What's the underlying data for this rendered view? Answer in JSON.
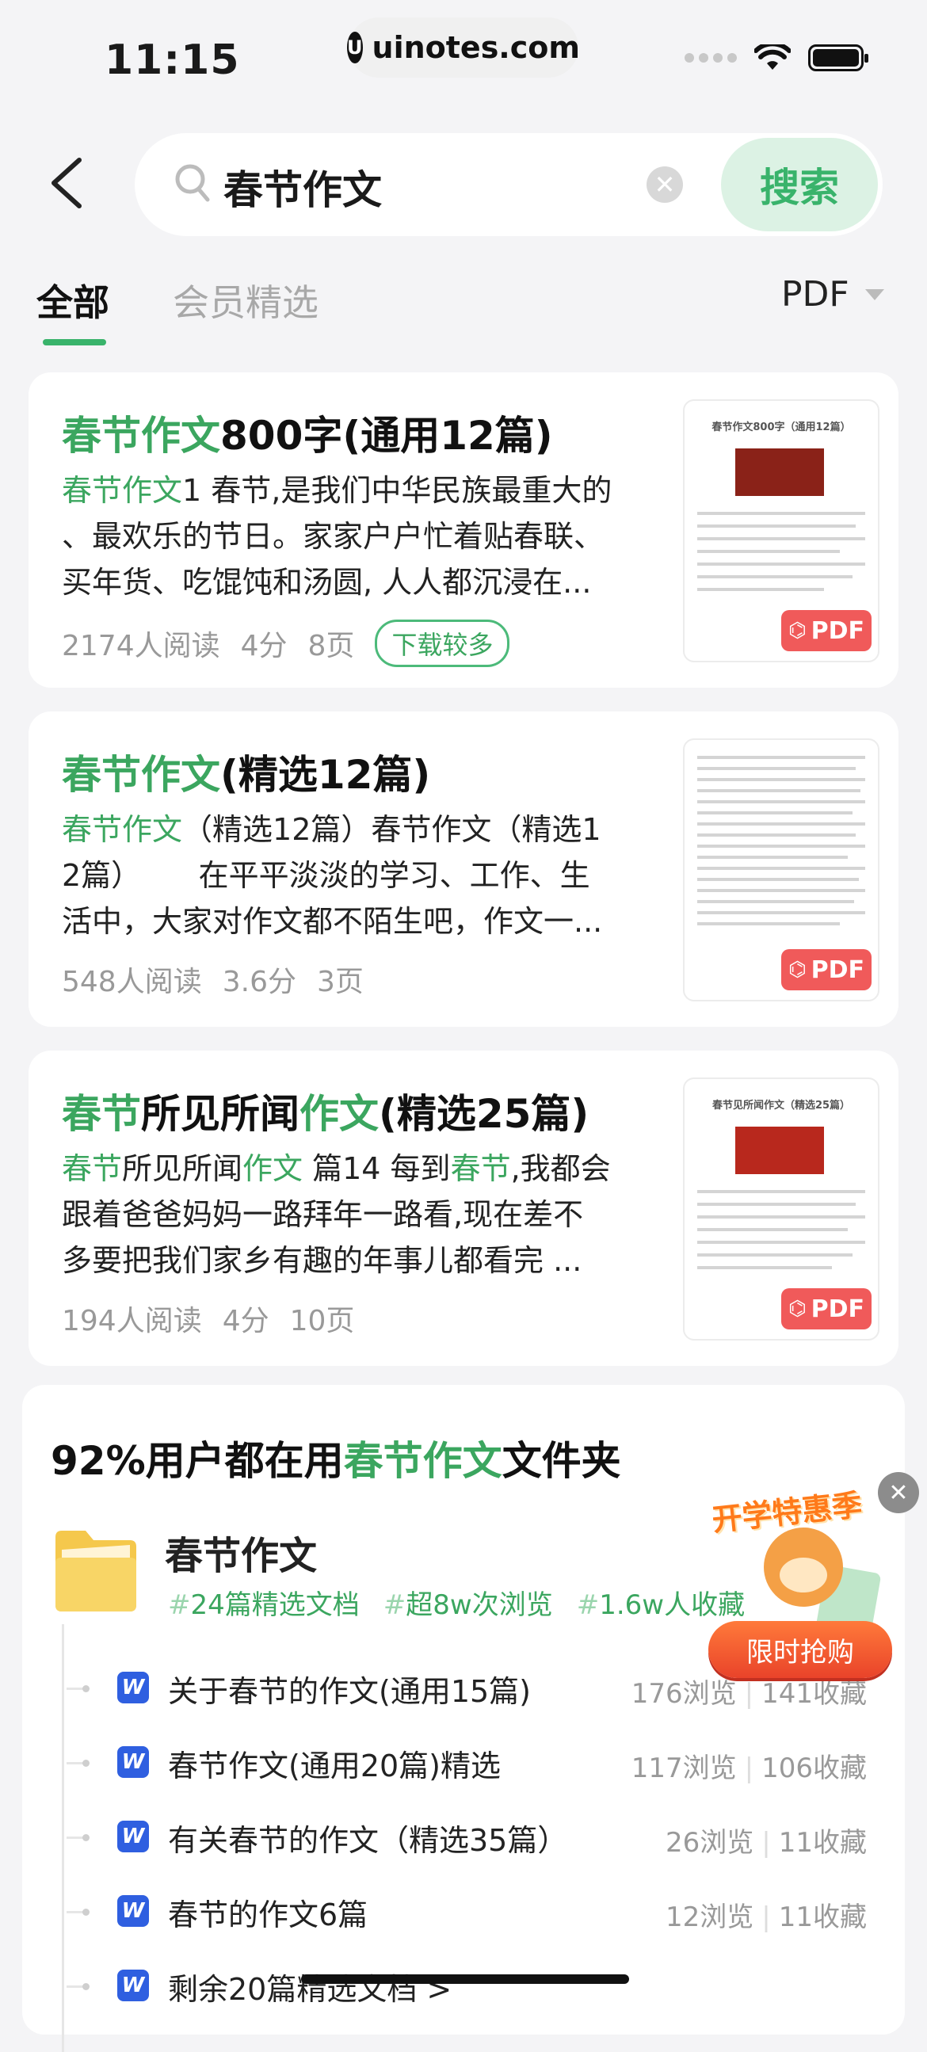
{
  "status_bar": {
    "time": "11:15",
    "url": "uinotes.com",
    "url_logo": "U"
  },
  "search": {
    "query": "春节作文",
    "button_label": "搜索",
    "clear_icon": "clear-icon"
  },
  "tabs": [
    {
      "label": "全部",
      "active": true
    },
    {
      "label": "会员精选",
      "active": false
    }
  ],
  "filter": {
    "label": "PDF"
  },
  "colors": {
    "accent": "#3ba65f",
    "badge_border": "#4cba7a",
    "pdf_red": "#f05a5a",
    "word_blue": "#2f5fe0"
  },
  "results": [
    {
      "title_parts": [
        "春节作文",
        "800字(通用12篇)",
        "",
        ""
      ],
      "snippet_lines": [
        [
          "春节作文",
          "1 春节,是我们中华民族最重大的"
        ],
        [
          "",
          "、最欢乐的节日。家家户户忙着贴春联、"
        ],
        [
          "",
          "买年货、吃馄饨和汤圆, 人人都沉浸在..."
        ]
      ],
      "reads": "2174人阅读",
      "score": "4分",
      "pages": "8页",
      "badge": "下载较多",
      "thumb_title": "春节作文800字（通用12篇）",
      "pdf_label": "PDF"
    },
    {
      "title_parts": [
        "春节作文",
        "(精选12篇)",
        "",
        ""
      ],
      "snippet_lines": [
        [
          "春节作文",
          "（精选12篇）春节作文（精选1"
        ],
        [
          "",
          "2篇）      在平平淡淡的学习、工作、生"
        ],
        [
          "",
          "活中，大家对作文都不陌生吧，作文一..."
        ]
      ],
      "reads": "548人阅读",
      "score": "3.6分",
      "pages": "3页",
      "badge": "",
      "thumb_title": "",
      "pdf_label": "PDF"
    },
    {
      "title_parts": [
        "春节",
        "所见所闻",
        "作文",
        "(精选25篇)"
      ],
      "snippet_lines": [
        [
          "春节",
          "所见所闻",
          "作文",
          " 篇14 每到",
          "春节",
          ",我都会"
        ],
        [
          "",
          "跟着爸爸妈妈一路拜年一路看,现在差不"
        ],
        [
          "",
          "多要把我们家乡有趣的年事儿都看完 ..."
        ]
      ],
      "reads": "194人阅读",
      "score": "4分",
      "pages": "10页",
      "badge": "",
      "thumb_title": "春节见所闻作文（精选25篇）",
      "pdf_label": "PDF"
    }
  ],
  "folder": {
    "headline_prefix": "92%用户都在用",
    "headline_highlight": "春节作文",
    "headline_suffix": "文件夹",
    "name": "春节作文",
    "tags": [
      "24篇精选文档",
      "超8w次浏览",
      "1.6w人收藏"
    ],
    "docs": [
      {
        "name": "关于春节的作文(通用15篇)",
        "views": "176浏览",
        "favs": "141收藏"
      },
      {
        "name": "春节作文(通用20篇)精选",
        "views": "117浏览",
        "favs": "106收藏"
      },
      {
        "name": "有关春节的作文（精选35篇）",
        "views": "26浏览",
        "favs": "11收藏"
      },
      {
        "name": "春节的作文6篇",
        "views": "12浏览",
        "favs": "11收藏"
      },
      {
        "name": "剩余20篇精选文档 >",
        "views": "",
        "favs": ""
      }
    ]
  },
  "promo": {
    "title": "开学特惠季",
    "button": "限时抢购"
  }
}
